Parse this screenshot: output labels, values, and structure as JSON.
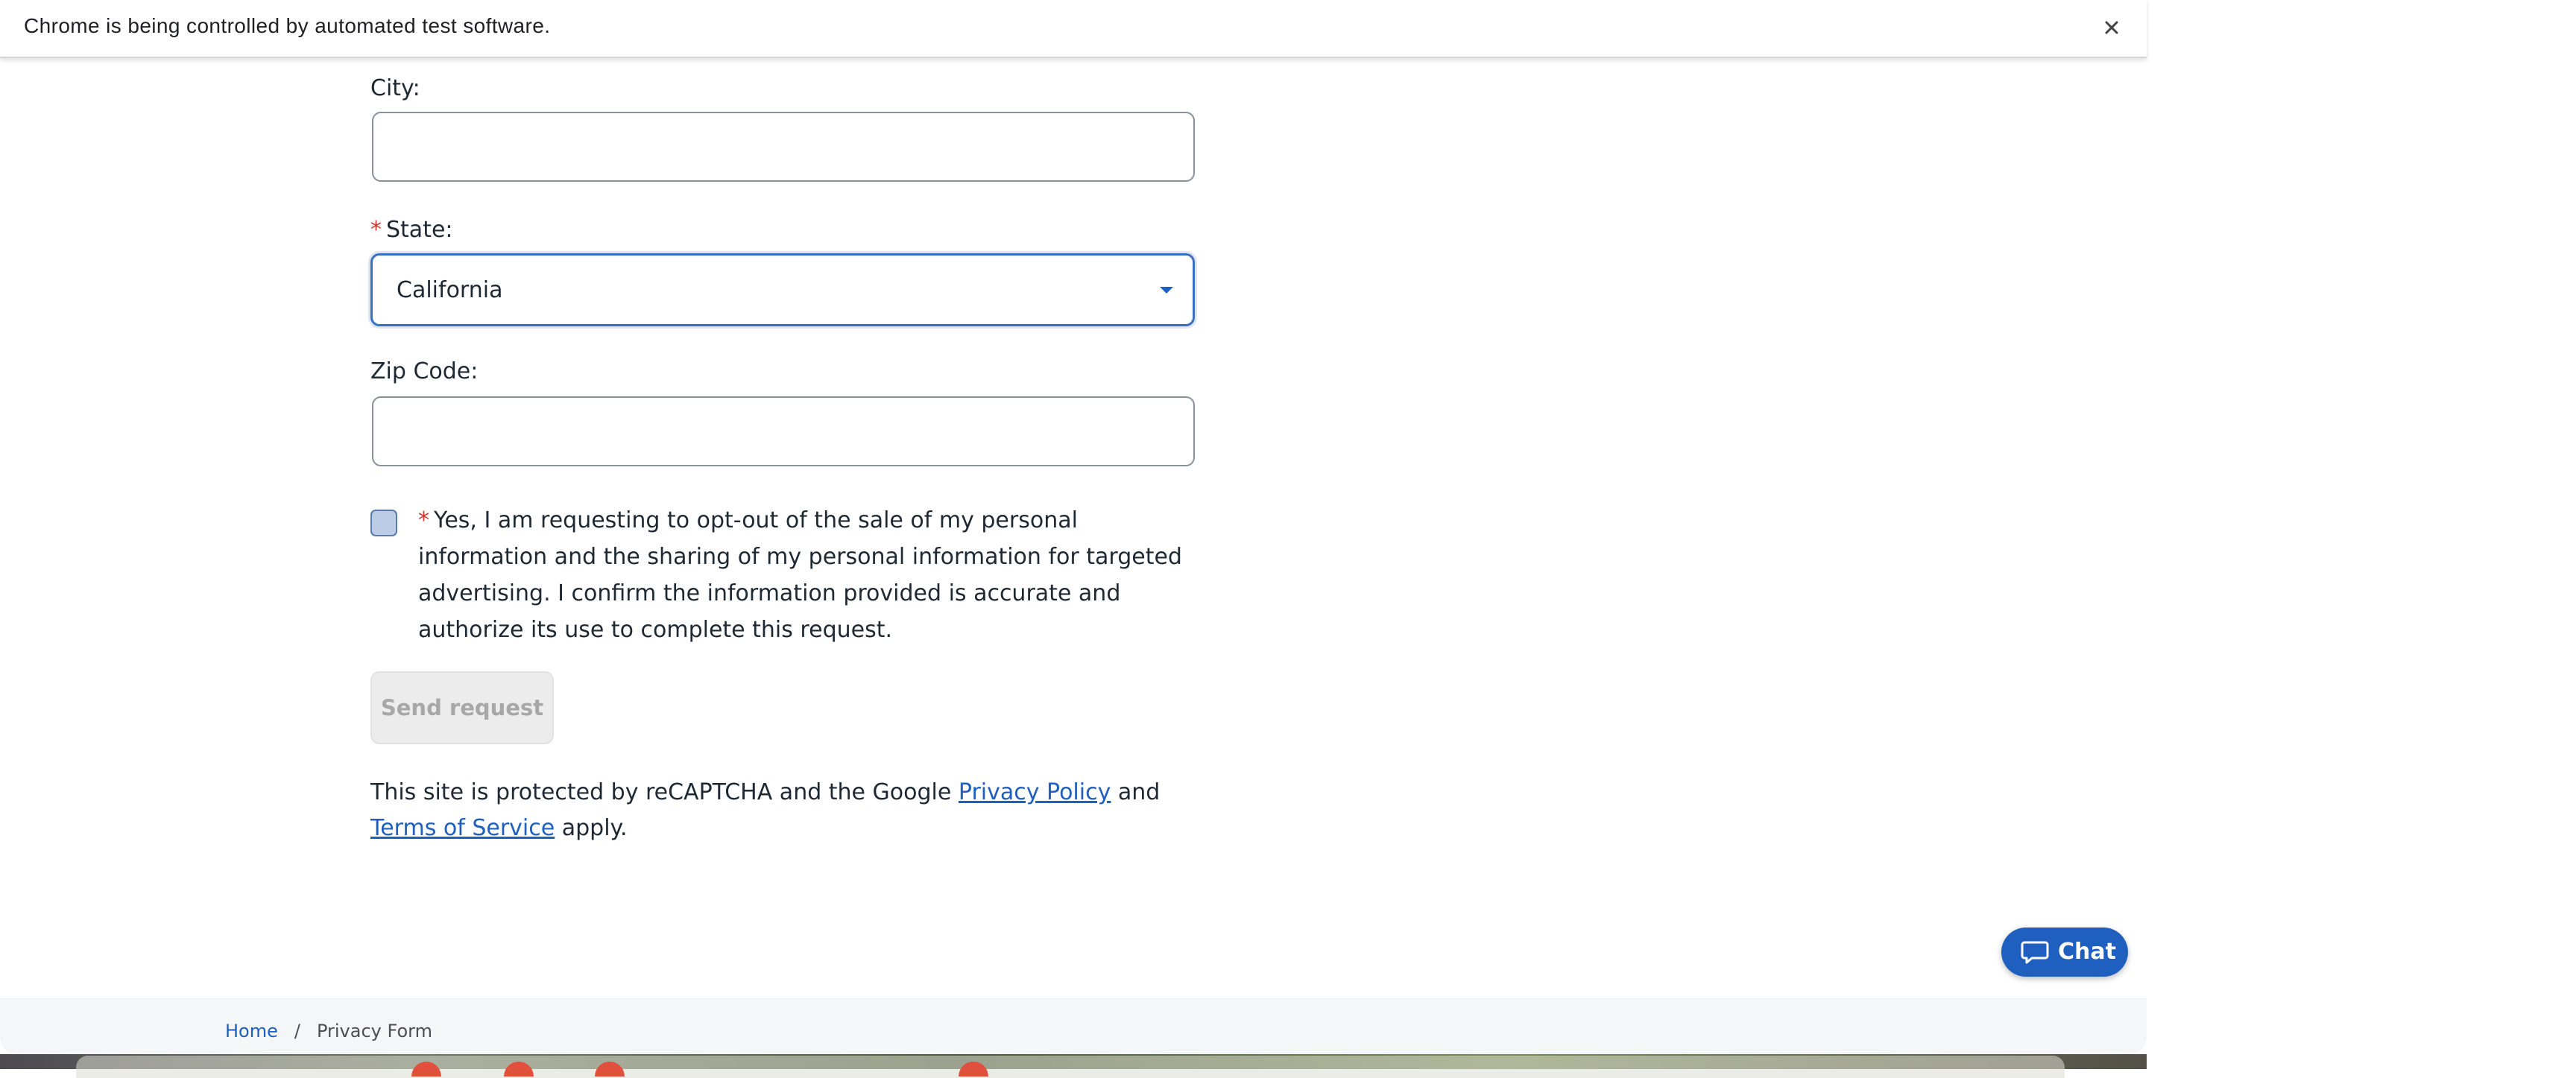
{
  "infobar": {
    "message": "Chrome is being controlled by automated test software.",
    "close_icon": "close-icon"
  },
  "form": {
    "city": {
      "label": "City:",
      "value": ""
    },
    "state": {
      "required_marker": "*",
      "label": "State:",
      "selected": "California"
    },
    "zip": {
      "label": "Zip Code:",
      "value": ""
    },
    "consent": {
      "required_marker": "*",
      "text": "Yes, I am requesting to opt-out of the sale of my personal information and the sharing of my personal information for targeted advertising. I confirm the information provided is accurate and authorize its use to complete this request.",
      "checked": false
    },
    "send_label": "Send request"
  },
  "recaptcha": {
    "prefix": "This site is protected by reCAPTCHA and the Google ",
    "privacy_link": "Privacy Policy",
    "middle": " and ",
    "terms_link": "Terms of Service",
    "suffix": " apply."
  },
  "breadcrumb": {
    "home": "Home",
    "separator": "/",
    "current": "Privacy Form"
  },
  "chat": {
    "label": "Chat",
    "icon": "chat-bubble-icon"
  },
  "colors": {
    "accent": "#1f5fbf",
    "required": "#d0342c",
    "disabled_button_bg": "#ececec",
    "disabled_button_text": "#a7a7a7"
  }
}
